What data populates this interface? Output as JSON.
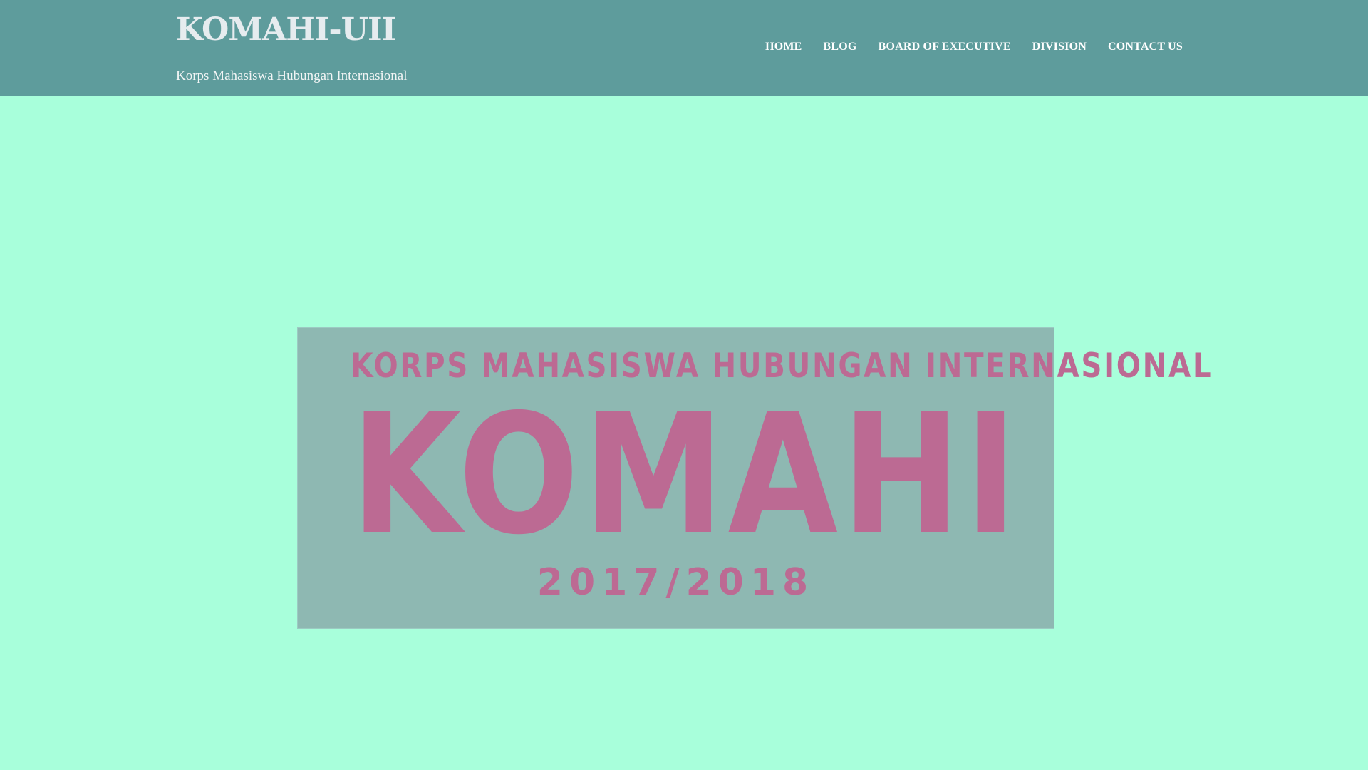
{
  "header": {
    "title": "KOMAHI-UII",
    "tagline": "Korps Mahasiswa Hubungan Internasional",
    "background_color": "#5e9c9c"
  },
  "nav": {
    "items": [
      {
        "label": "HOME"
      },
      {
        "label": "BLOG"
      },
      {
        "label": "BOARD OF EXECUTIVE"
      },
      {
        "label": "DIVISION"
      },
      {
        "label": "CONTACT US"
      }
    ]
  },
  "hero": {
    "banner_top_text": "KORPS MAHASISWA HUBUNGAN INTERNASIONAL",
    "banner_main_text": "KOMAHI",
    "banner_year_text": "2017/2018",
    "banner_background": "#8eb8b2",
    "banner_text_color": "#bc6a93"
  },
  "page": {
    "background_color": "#a8ffdb"
  }
}
